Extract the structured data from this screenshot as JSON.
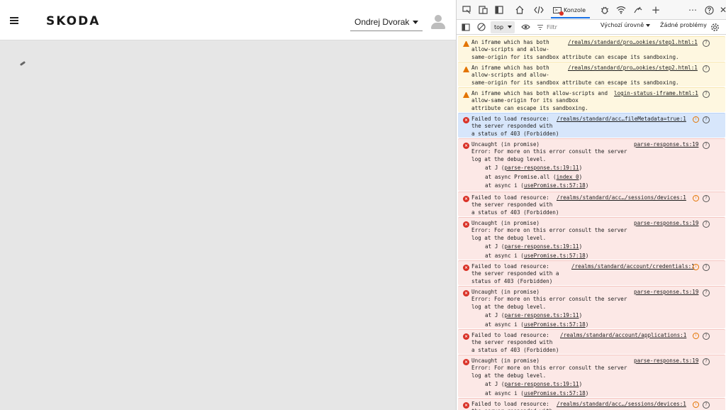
{
  "app": {
    "brand": "SKODA",
    "user_name": "Ondrej Dvorak"
  },
  "devtools": {
    "tabs": {
      "console_label": "Konzole"
    },
    "toolbar": {
      "context": "top",
      "filter_placeholder": "Filtr",
      "levels": "Výchozí úrovně",
      "issues": "Žádné problémy"
    },
    "messages": [
      {
        "type": "warning",
        "text": "An iframe which has both\nallow-scripts and allow-\nsame-origin for its sandbox attribute can escape its sandboxing.",
        "source": "/realms/standard/pro…ookies/step1.html:1"
      },
      {
        "type": "warning",
        "text": "An iframe which has both\nallow-scripts and allow-\nsame-origin for its sandbox attribute can escape its sandboxing.",
        "source": "/realms/standard/pro…ookies/step2.html:1"
      },
      {
        "type": "warning",
        "text": "An iframe which has both allow-scripts and\nallow-same-origin for its sandbox\nattribute can escape its sandboxing.",
        "source": "login-status-iframe.html:1"
      },
      {
        "type": "error",
        "text": "Failed to load resource:\nthe server responded with\na status of 403 (Forbidden)",
        "source": "/realms/standard/acc…fileMetadata=true:1"
      },
      {
        "type": "error",
        "text": "Uncaught (in promise)\nError: For more on this error consult the server\nlog at the debug level.",
        "source": "parse-response.ts:19",
        "stack": [
          {
            "pre": "at J (",
            "link": "parse-response.ts:19:11",
            "post": ")"
          },
          {
            "pre": "at async Promise.all (",
            "link": "index 0",
            "post": ")"
          },
          {
            "pre": "at async i (",
            "link": "usePromise.ts:57:18",
            "post": ")"
          }
        ]
      },
      {
        "type": "error",
        "text": "Failed to load resource:\nthe server responded with\na status of 403 (Forbidden)",
        "source": "/realms/standard/acc…/sessions/devices:1"
      },
      {
        "type": "error",
        "text": "Uncaught (in promise)\nError: For more on this error consult the server\nlog at the debug level.",
        "source": "parse-response.ts:19",
        "stack": [
          {
            "pre": "at J (",
            "link": "parse-response.ts:19:11",
            "post": ")"
          },
          {
            "pre": "at async i (",
            "link": "usePromise.ts:57:18",
            "post": ")"
          }
        ]
      },
      {
        "type": "error",
        "text": "Failed to load resource:\nthe server responded with a\nstatus of 403 (Forbidden)",
        "source": "/realms/standard/account/credentials:1"
      },
      {
        "type": "error",
        "text": "Uncaught (in promise)\nError: For more on this error consult the server\nlog at the debug level.",
        "source": "parse-response.ts:19",
        "stack": [
          {
            "pre": "at J (",
            "link": "parse-response.ts:19:11",
            "post": ")"
          },
          {
            "pre": "at async i (",
            "link": "usePromise.ts:57:18",
            "post": ")"
          }
        ]
      },
      {
        "type": "error",
        "text": "Failed to load resource:\nthe server responded with\na status of 403 (Forbidden)",
        "source": "/realms/standard/account/applications:1"
      },
      {
        "type": "error",
        "text": "Uncaught (in promise)\nError: For more on this error consult the server\nlog at the debug level.",
        "source": "parse-response.ts:19",
        "stack": [
          {
            "pre": "at J (",
            "link": "parse-response.ts:19:11",
            "post": ")"
          },
          {
            "pre": "at async i (",
            "link": "usePromise.ts:57:18",
            "post": ")"
          }
        ]
      },
      {
        "type": "error",
        "text": "Failed to load resource:\nthe server responded with",
        "source": "/realms/standard/acc…/sessions/devices:1"
      }
    ]
  }
}
